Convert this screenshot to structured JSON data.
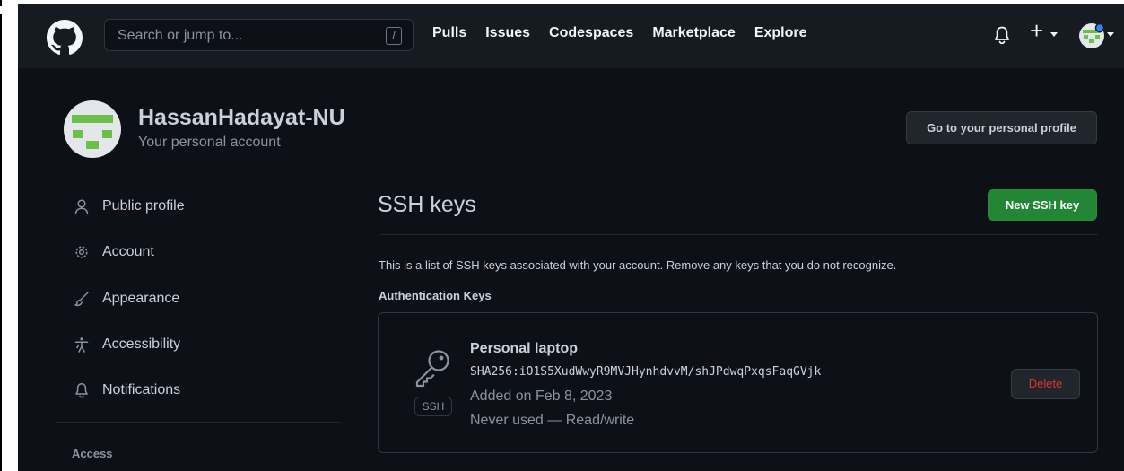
{
  "header": {
    "search_placeholder": "Search or jump to...",
    "search_shortcut": "/",
    "nav": [
      "Pulls",
      "Issues",
      "Codespaces",
      "Marketplace",
      "Explore"
    ],
    "icons": [
      "github-logo",
      "bell-icon",
      "plus-icon",
      "avatar"
    ]
  },
  "account": {
    "name": "HassanHadayat-NU",
    "subtitle": "Your personal account",
    "profile_button": "Go to your personal profile"
  },
  "sidebar": {
    "items": [
      {
        "label": "Public profile",
        "icon": "person-icon"
      },
      {
        "label": "Account",
        "icon": "gear-icon"
      },
      {
        "label": "Appearance",
        "icon": "paintbrush-icon"
      },
      {
        "label": "Accessibility",
        "icon": "accessibility-icon"
      },
      {
        "label": "Notifications",
        "icon": "bell-icon"
      }
    ],
    "section_label": "Access"
  },
  "main": {
    "title": "SSH keys",
    "new_key_button": "New SSH key",
    "intro": "This is a list of SSH keys associated with your account. Remove any keys that you do not recognize.",
    "auth_heading": "Authentication Keys",
    "keys": [
      {
        "name": "Personal laptop",
        "badge": "SSH",
        "fingerprint": "SHA256:iO1S5XudWwyR9MVJHynhdvvM/shJPdwqPxqsFaqGVjk",
        "added": "Added on Feb 8, 2023",
        "usage": "Never used — Read/write",
        "delete_label": "Delete"
      }
    ]
  },
  "colors": {
    "background": "#0d1117",
    "header_bg": "#161b22",
    "primary_green": "#238636",
    "danger_red": "#da3633",
    "avatar_green": "#6cc04a"
  }
}
